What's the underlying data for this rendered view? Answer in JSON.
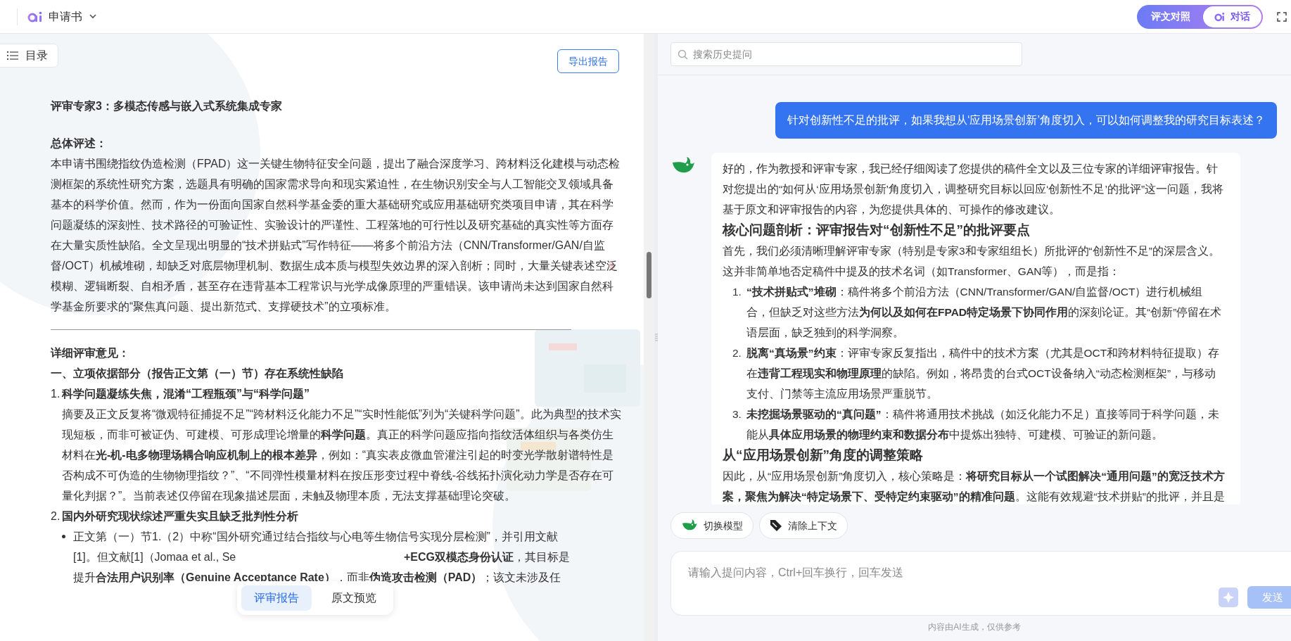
{
  "header": {
    "app_title": "申请书",
    "view_toggle": [
      {
        "label": "评文对照",
        "selected": false,
        "icon": false
      },
      {
        "label": "对话",
        "selected": true,
        "icon": true
      }
    ]
  },
  "report": {
    "toc_button": "目录",
    "export_button": "导出报告",
    "blocks": [
      {
        "kind": "title",
        "text": "评审专家3：多模态传感与嵌入式系统集成专家"
      },
      {
        "kind": "label",
        "text": "总体评述："
      },
      {
        "kind": "paragraph",
        "text": "本申请书围绕指纹伪造检测（FPAD）这一关键生物特征安全问题，提出了融合深度学习、跨材料泛化建模与动态检测框架的系统性研究方案，选题具有明确的国家需求导向和现实紧迫性，在生物识别安全与人工智能交叉领域具备基本的科学价值。然而，作为一份面向国家自然科学基金委的重大基础研究或应用基础研究类项目申请，其在科学问题凝练的深刻性、技术路径的可验证性、实验设计的严谨性、工程落地的可行性以及研究基础的真实性等方面存在大量实质性缺陷。全文呈现出明显的“技术拼贴式”写作特征——将多个前沿方法（CNN/Transformer/GAN/自监督/OCT）机械堆砌，却缺乏对底层物理机制、数据生成本质与模型失效边界的深入剖析；同时，大量关键表述空泛模糊、逻辑断裂、自相矛盾，甚至存在违背基本工程常识与光学成像原理的严重错误。该申请尚未达到国家自然科学基金所要求的“聚焦真问题、提出新范式、支撑硬技术”的立项标准。"
      },
      {
        "kind": "rule"
      },
      {
        "kind": "label",
        "text": "详细评审意见："
      },
      {
        "kind": "label",
        "text": "一、立项依据部分（报告正文第（一）节）存在系统性缺陷"
      },
      {
        "kind": "numbered",
        "marker": "1.",
        "title": "科学问题凝练失焦，混淆“工程瓶颈”与“科学问题”",
        "body": "摘要及正文反复将“微观特征捕捉不足”“跨材料泛化能力不足”“实时性能低”列为“关键科学问题”。此为典型的技术实现短板，而非可被证伪、可建模、可形成理论增量的**科学问题**。真正的科学问题应指向指纹活体组织与各类仿生材料在**光-机-电多物理场耦合响应机制上的根本差异**，例如：“真实表皮微血管灌注引起的时变光学散射谱特性是否构成不可伪造的生物物理指纹？”、“不同弹性模量材料在按压形变过程中脊线-谷线拓扑演化动力学是否存在可量化判据？”。当前表述仅停留在现象描述层面，未触及物理本质，无法支撑基础理论突破。"
      },
      {
        "kind": "numbered",
        "marker": "2.",
        "title": "国内外研究现状综述严重失实且缺乏批判性分析"
      },
      {
        "kind": "bullet",
        "lines": [
          [
            "正文第（一）节1.（2）中称“国外研究通过结合指纹与心电等生物信号实现分层检测”，并引用文献"
          ],
          [
            "[1]。但文献[1]（Jomaa et al., Se",
            "**+ECG双模态身份认证**，其目标是"
          ],
          [
            "提升**合法用户识别率（Genuine Acceptance Rate）**，而非**伪造攻击检测（PAD）**；该文未涉及任"
          ]
        ]
      }
    ],
    "view_tabs": [
      {
        "label": "评审报告",
        "selected": true
      },
      {
        "label": "原文预览",
        "selected": false
      }
    ]
  },
  "chat": {
    "search_placeholder": "搜索历史提问",
    "messages": [
      {
        "kind": "user",
        "text": "针对创新性不足的批评，如果我想从‘应用场景创新’角度切入，可以如何调整我的研究目标表述？"
      },
      {
        "kind": "assistant",
        "blocks": [
          {
            "kind": "paragraph",
            "text": "好的，作为教授和评审专家，我已经仔细阅读了您提供的稿件全文以及三位专家的详细评审报告。针对您提出的“如何从‘应用场景创新’角度切入，调整研究目标以回应‘创新性不足’的批评”这一问题，我将基于原文和评审报告的内容，为您提供具体的、可操作的修改建议。"
          },
          {
            "kind": "heading",
            "text": "核心问题剖析：评审报告对“创新性不足”的批评要点"
          },
          {
            "kind": "paragraph",
            "text": "首先，我们必须清晰理解评审专家（特别是专家3和专家组组长）所批评的“创新性不足”的深层含义。这并非简单地否定稿件中提及的技术名词（如Transformer、GAN等），而是指："
          },
          {
            "kind": "list",
            "items": [
              {
                "marker": "1.",
                "text": "**“技术拼贴式”堆砌**：稿件将多个前沿方法（CNN/Transformer/GAN/自监督/OCT）进行机械组合，但缺乏对这些方法**为何以及如何在FPAD特定场景下协同作用**的深刻论证。其“创新”停留在术语层面，缺乏独到的科学洞察。"
              },
              {
                "marker": "2.",
                "text": "**脱离“真场景”约束**：评审专家反复指出，稿件中的技术方案（尤其是OCT和跨材料特征提取）存在**违背工程现实和物理原理**的缺陷。例如，将昂贵的台式OCT设备纳入“动态检测框架”，与移动支付、门禁等主流应用场景严重脱节。"
              },
              {
                "marker": "3.",
                "text": "**未挖掘场景驱动的“真问题”**：稿件将通用技术挑战（如泛化能力不足）直接等同于科学问题，未能从**具体应用场景的物理约束和数据分布**中提炼出独特、可建模、可验证的新问题。"
              }
            ]
          },
          {
            "kind": "heading",
            "text": "从“应用场景创新”角度的调整策略"
          },
          {
            "kind": "paragraph",
            "text": "因此，从“应用场景创新”角度切入，核心策略是：**将研究目标从一个试图解决“通用问题”的宽泛技术方案，聚焦为解决“特定场景下、受特定约束驱动”的精准问题**。这能有效规避“技术拼贴”的批评，并且是"
          }
        ]
      }
    ],
    "tools": [
      {
        "kind": "model",
        "label": "切换模型"
      },
      {
        "kind": "clear",
        "label": "清除上下文"
      }
    ],
    "input_placeholder": "请输入提问内容，Ctrl+回车换行，回车发送",
    "send_button": "发送",
    "disclaimer": "内容由AI生成，仅供参考"
  }
}
